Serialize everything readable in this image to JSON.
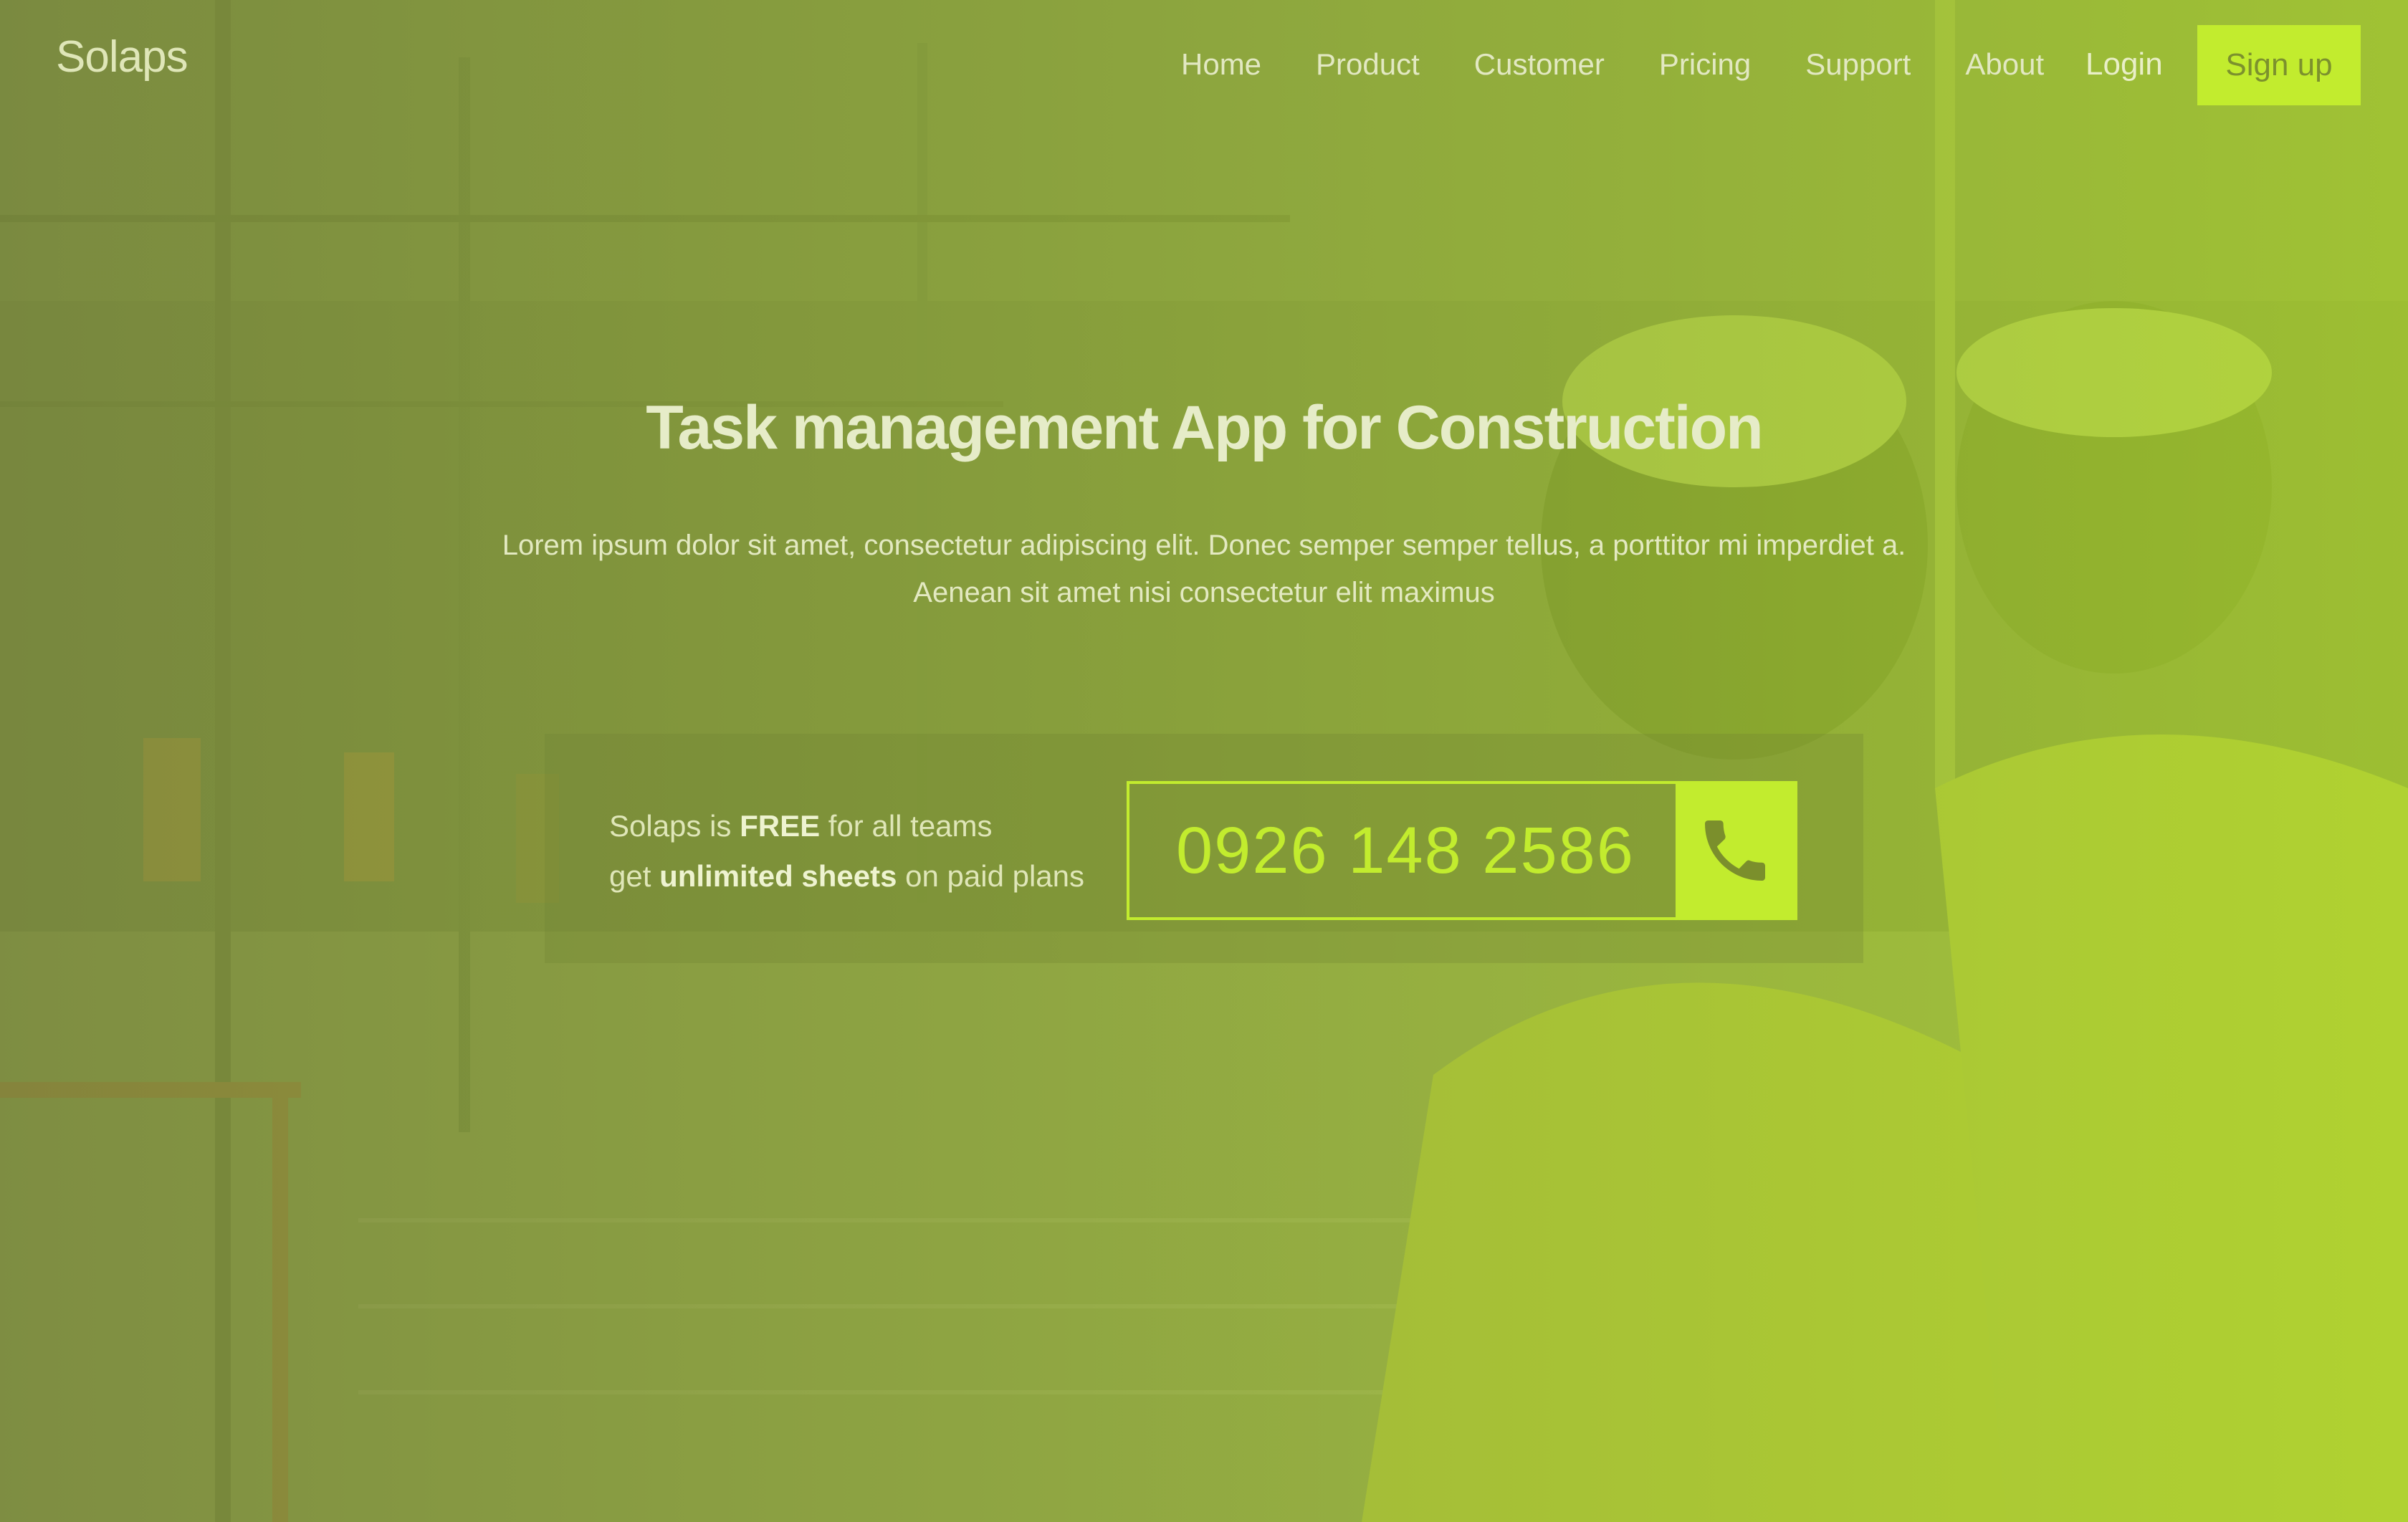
{
  "brand": {
    "logo": "Solaps"
  },
  "nav": {
    "items": [
      {
        "label": "Home"
      },
      {
        "label": "Product"
      },
      {
        "label": "Customer"
      },
      {
        "label": "Pricing"
      },
      {
        "label": "Support"
      },
      {
        "label": "About"
      }
    ],
    "login": "Login",
    "signup": "Sign up"
  },
  "hero": {
    "title": "Task management App for Construction",
    "subtitle_line1": "Lorem ipsum dolor sit amet, consectetur adipiscing elit. Donec semper semper tellus, a porttitor mi imperdiet a.",
    "subtitle_line2": "Aenean sit amet nisi consectetur elit maximus"
  },
  "offer": {
    "line1_prefix": "Solaps is ",
    "line1_strong": "FREE",
    "line1_suffix": " for all teams",
    "line2_prefix": "get ",
    "line2_strong": "unlimited sheets",
    "line2_suffix": " on paid plans"
  },
  "contact": {
    "phone": "0926 148 2586",
    "call_icon": "phone-icon"
  },
  "colors": {
    "accent": "#c2ec2e",
    "overlay": "#9bb33f",
    "text_light": "#e6ecc8"
  }
}
